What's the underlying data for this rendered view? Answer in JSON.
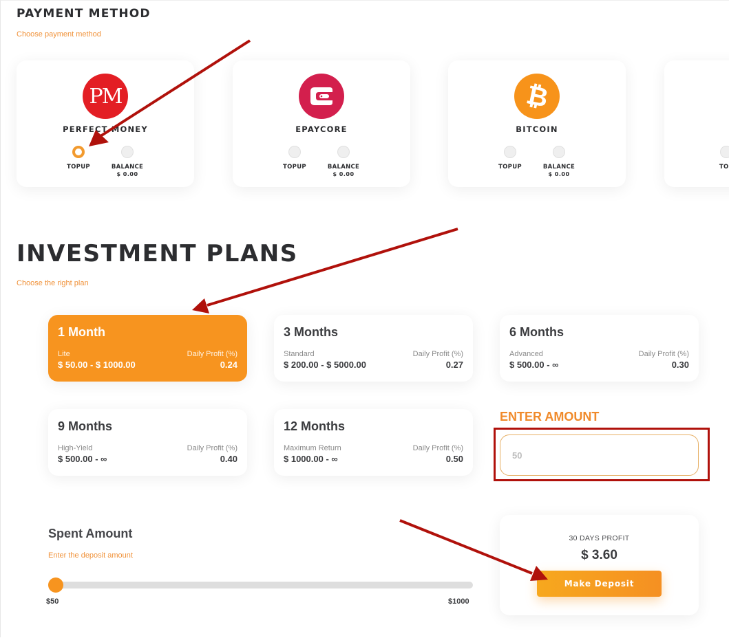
{
  "payment": {
    "title": "PAYMENT METHOD",
    "subtitle": "Choose payment method",
    "methods": [
      {
        "name": "PERFECT MONEY",
        "logo": "perfect-money-logo",
        "logo_text": "PM",
        "color": "#e31e24",
        "topup_label": "TOPUP",
        "balance_label": "BALANCE",
        "balance_value": "$ 0.00",
        "selected": "topup"
      },
      {
        "name": "EPAYCORE",
        "logo": "epaycore-logo",
        "color": "#d31f4d",
        "topup_label": "TOPUP",
        "balance_label": "BALANCE",
        "balance_value": "$ 0.00",
        "selected": null
      },
      {
        "name": "BITCOIN",
        "logo": "bitcoin-logo",
        "logo_text": "₿",
        "color": "#f7931a",
        "topup_label": "TOPUP",
        "balance_label": "BALANCE",
        "balance_value": "$ 0.00",
        "selected": null
      },
      {
        "name": "",
        "topup_label": "TOP",
        "selected": null
      }
    ]
  },
  "plans": {
    "title": "INVESTMENT PLANS",
    "subtitle": "Choose the right plan",
    "daily_profit_label": "Daily Profit (%)",
    "items": [
      {
        "title": "1 Month",
        "tier": "Lite",
        "range": "$ 50.00 - $ 1000.00",
        "daily_profit": "0.24",
        "active": true
      },
      {
        "title": "3 Months",
        "tier": "Standard",
        "range": "$ 200.00 - $ 5000.00",
        "daily_profit": "0.27",
        "active": false
      },
      {
        "title": "6 Months",
        "tier": "Advanced",
        "range": "$ 500.00 - ∞",
        "daily_profit": "0.30",
        "active": false
      },
      {
        "title": "9 Months",
        "tier": "High-Yield",
        "range": "$ 500.00 - ∞",
        "daily_profit": "0.40",
        "active": false
      },
      {
        "title": "12 Months",
        "tier": "Maximum Return",
        "range": "$ 1000.00 - ∞",
        "daily_profit": "0.50",
        "active": false
      }
    ]
  },
  "amount": {
    "label": "ENTER AMOUNT",
    "placeholder": "50",
    "value": ""
  },
  "spent": {
    "title": "Spent Amount",
    "subtitle": "Enter the deposit amount",
    "min_label": "$50",
    "max_label": "$1000",
    "min": 50,
    "max": 1000,
    "value": 50
  },
  "profit": {
    "label": "30 DAYS PROFIT",
    "value": "$ 3.60",
    "button_label": "Make Deposit"
  },
  "colors": {
    "accent": "#f7941f",
    "annotation": "#b0110b"
  }
}
